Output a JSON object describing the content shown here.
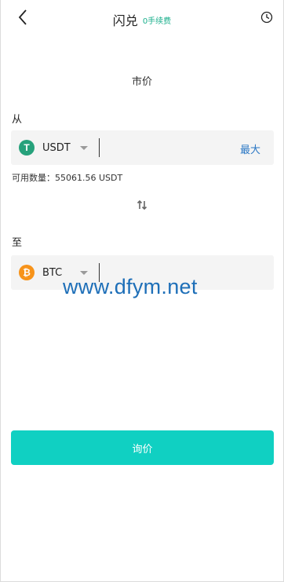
{
  "header": {
    "title": "闪兑",
    "fee_badge": "0手续费"
  },
  "order_type": "市价",
  "from": {
    "label": "从",
    "coin": "USDT",
    "coin_glyph": "T",
    "coin_color": "#26a17b",
    "amount_value": "",
    "max_label": "最大"
  },
  "balance": {
    "text": "可用数量：55061.56 USDT"
  },
  "to": {
    "label": "至",
    "coin": "BTC",
    "coin_glyph": "₿",
    "coin_color": "#f7931a",
    "amount_value": ""
  },
  "watermark": "www.dfym.net",
  "quote_button": "询价",
  "colors": {
    "accent": "#10d0c2",
    "fee_green": "#1aaf8c",
    "link_blue": "#2b78c5"
  }
}
